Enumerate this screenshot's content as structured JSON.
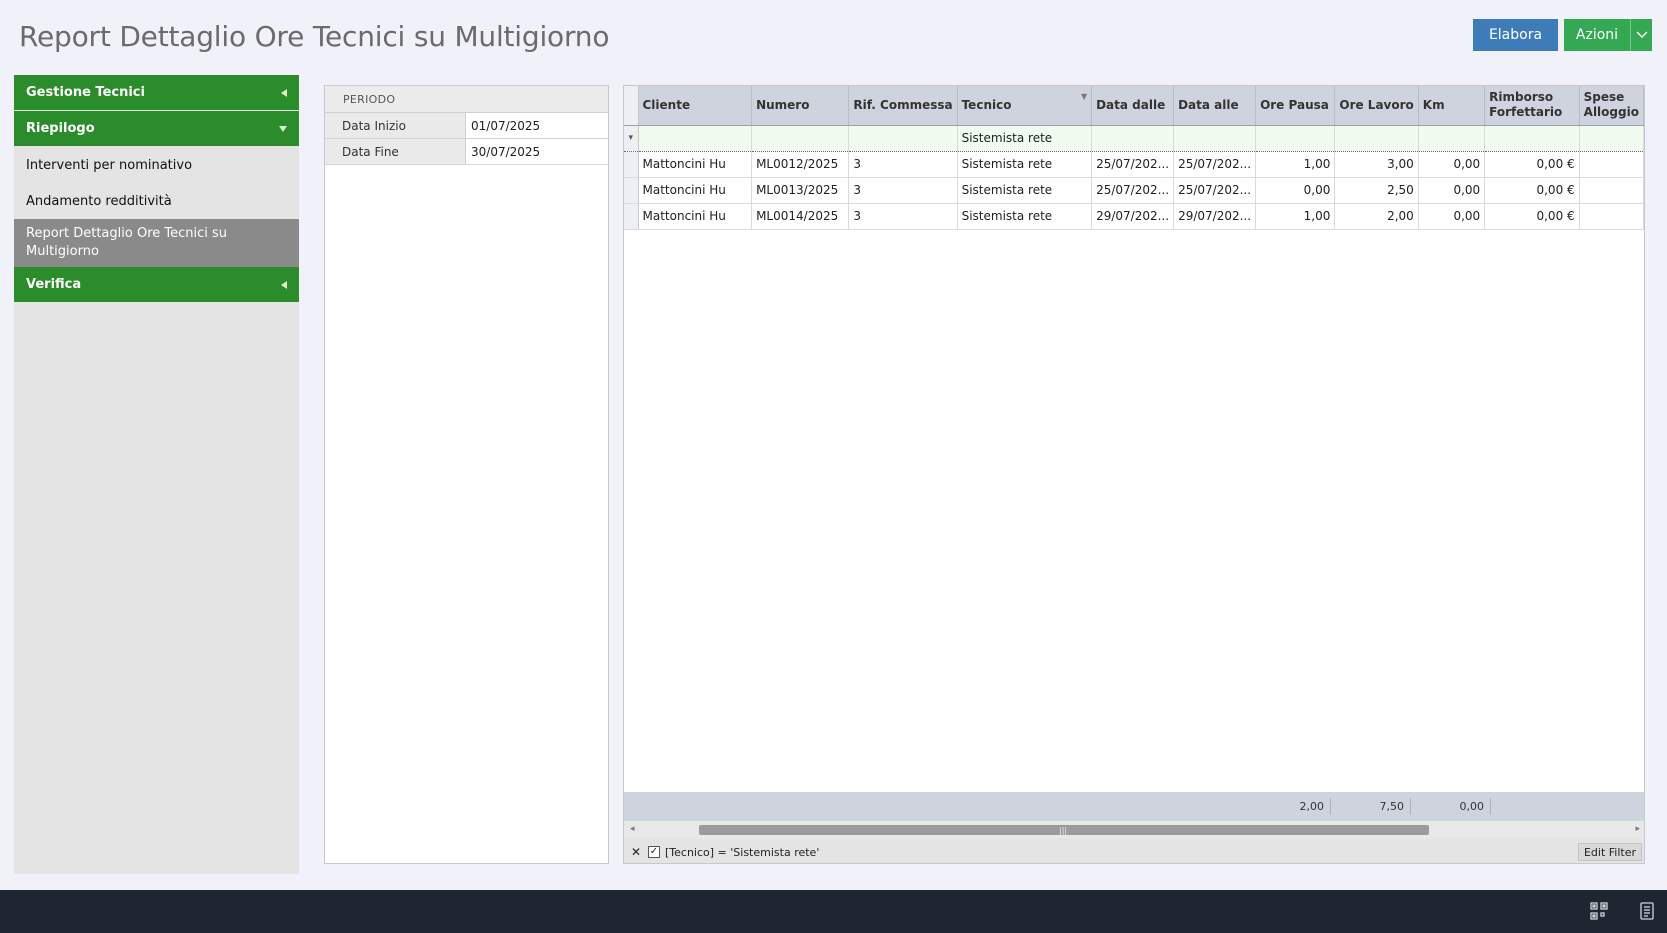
{
  "page": {
    "title": "Report Dettaglio Ore Tecnici su Multigiorno"
  },
  "toolbar": {
    "elabora_label": "Elabora",
    "azioni_label": "Azioni"
  },
  "sidebar": {
    "groups": [
      {
        "label": "Gestione Tecnici"
      },
      {
        "label": "Riepilogo"
      },
      {
        "label": "Verifica"
      }
    ],
    "items": [
      {
        "label": "Interventi per nominativo"
      },
      {
        "label": "Andamento redditività"
      },
      {
        "label": "Report Dettaglio Ore Tecnici su Multigiorno"
      }
    ]
  },
  "period": {
    "header": "PERIODO",
    "start_label": "Data Inizio",
    "start_value": "01/07/2025",
    "end_label": "Data Fine",
    "end_value": "30/07/2025"
  },
  "grid": {
    "columns": [
      "Cliente",
      "Numero",
      "Rif. Commessa",
      "Tecnico",
      "Data dalle",
      "Data alle",
      "Ore Pausa",
      "Ore Lavoro",
      "Km",
      "Rimborso Forfettario",
      "Spese Alloggio"
    ],
    "filter_row": {
      "tecnico": "Sistemista rete"
    },
    "rows": [
      [
        "Mattoncini Hu",
        "ML0012/2025",
        "3",
        "Sistemista rete",
        "25/07/202...",
        "25/07/202...",
        "1,00",
        "3,00",
        "0,00",
        "0,00 €"
      ],
      [
        "Mattoncini Hu",
        "ML0013/2025",
        "3",
        "Sistemista rete",
        "25/07/202...",
        "25/07/202...",
        "0,00",
        "2,50",
        "0,00",
        "0,00 €"
      ],
      [
        "Mattoncini Hu",
        "ML0014/2025",
        "3",
        "Sistemista rete",
        "29/07/202...",
        "29/07/202...",
        "1,00",
        "2,00",
        "0,00",
        "0,00 €"
      ]
    ],
    "totals": {
      "ore_pausa": "2,00",
      "ore_lavoro": "7,50",
      "km": "0,00"
    },
    "filter_expression": "[Tecnico] = 'Sistemista rete'",
    "edit_filter_label": "Edit Filter"
  },
  "icons": {
    "filter": "filter-icon",
    "close": "close-icon",
    "checkbox": "check-icon",
    "qr": "qr-code-icon",
    "document": "document-icon"
  },
  "colors": {
    "accent_blue": "#3e7cb9",
    "accent_green": "#34a853",
    "sidebar_green": "#2a8c2a",
    "active_item": "#8a8a8a",
    "bottom_bar": "#1f2632"
  }
}
